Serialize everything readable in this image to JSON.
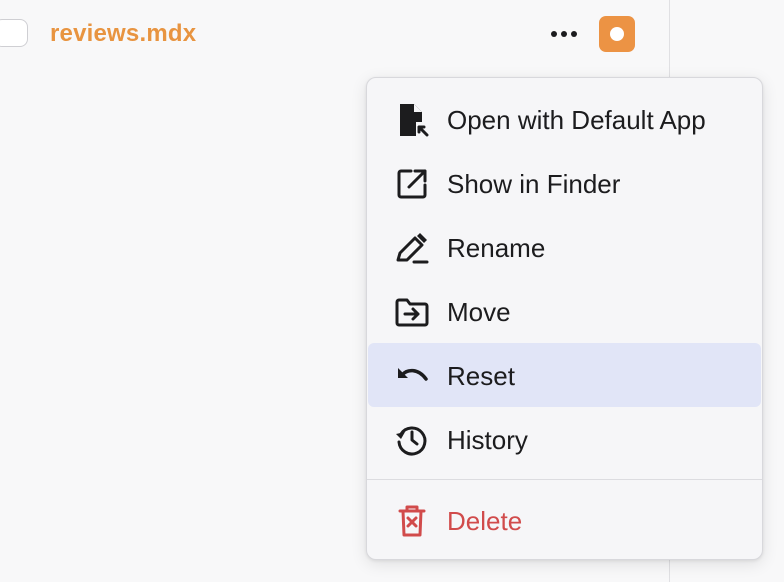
{
  "file": {
    "name": "reviews.mdx"
  },
  "colors": {
    "file_name": "#e89440",
    "status_badge": "#ec9344",
    "highlight": "#e1e5f7",
    "danger": "#d14b4b"
  },
  "menu": {
    "items": [
      {
        "label": "Open with Default App",
        "icon": "file-open-external-icon"
      },
      {
        "label": "Show in Finder",
        "icon": "external-link-icon"
      },
      {
        "label": "Rename",
        "icon": "pencil-edit-icon"
      },
      {
        "label": "Move",
        "icon": "folder-move-icon"
      },
      {
        "label": "Reset",
        "icon": "undo-arrow-icon",
        "highlighted": true
      },
      {
        "label": "History",
        "icon": "history-clock-icon"
      }
    ],
    "danger_item": {
      "label": "Delete",
      "icon": "trash-icon"
    }
  }
}
